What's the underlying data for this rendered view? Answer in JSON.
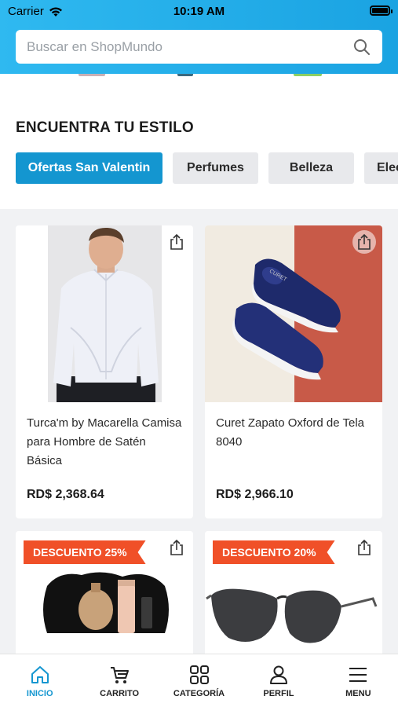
{
  "status_bar": {
    "carrier": "Carrier",
    "time": "10:19 AM"
  },
  "search": {
    "placeholder": "Buscar en ShopMundo"
  },
  "style_section": {
    "title": "ENCUENTRA TU ESTILO",
    "chips": [
      {
        "label": "Ofertas San Valentin",
        "active": true
      },
      {
        "label": "Perfumes",
        "active": false
      },
      {
        "label": "Belleza",
        "active": false
      },
      {
        "label": "Electrónica",
        "active": false
      }
    ]
  },
  "products": [
    {
      "name": "Turca'm by Macarella Camisa para Hombre de Satén Básica",
      "price": "RD$ 2,368.64",
      "badge": ""
    },
    {
      "name": "Curet Zapato Oxford de Tela 8040",
      "price": "RD$ 2,966.10",
      "badge": "",
      "brand_print": "CURET"
    },
    {
      "name": "",
      "price": "",
      "badge": "DESCUENTO 25%"
    },
    {
      "name": "",
      "price": "",
      "badge": "DESCUENTO 20%"
    }
  ],
  "tabbar": {
    "items": [
      {
        "label": "INICIO",
        "icon": "home-icon",
        "active": true
      },
      {
        "label": "CARRITO",
        "icon": "cart-icon",
        "active": false
      },
      {
        "label": "CATEGORÍA",
        "icon": "category-icon",
        "active": false
      },
      {
        "label": "PERFIL",
        "icon": "profile-icon",
        "active": false
      },
      {
        "label": "MENU",
        "icon": "menu-icon",
        "active": false
      }
    ]
  },
  "colors": {
    "accent": "#1496d0",
    "badge": "#f05028",
    "header": "#1aa3e2"
  }
}
